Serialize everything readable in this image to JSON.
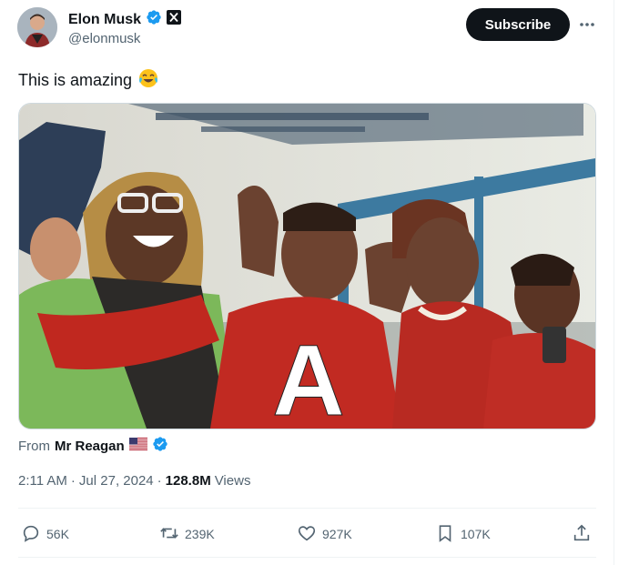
{
  "author": {
    "name": "Elon Musk",
    "handle": "@elonmusk",
    "verified": true,
    "affiliate_badge": "X"
  },
  "subscribe_label": "Subscribe",
  "tweet_text": "This is amazing",
  "tweet_emoji": "face-with-tears-of-joy-icon",
  "media": {
    "overlay_letter": "A",
    "type": "video"
  },
  "source": {
    "prefix": "From",
    "name": "Mr Reagan",
    "flag": "us-flag-icon",
    "verified": true
  },
  "meta": {
    "time": "2:11 AM",
    "date": "Jul 27, 2024",
    "views_count": "128.8M",
    "views_label": "Views"
  },
  "actions": {
    "replies": "56K",
    "reposts": "239K",
    "likes": "927K",
    "bookmarks": "107K"
  },
  "colors": {
    "accent": "#1d9bf0",
    "text": "#0f1419",
    "muted": "#536471",
    "button": "#0f1419"
  }
}
